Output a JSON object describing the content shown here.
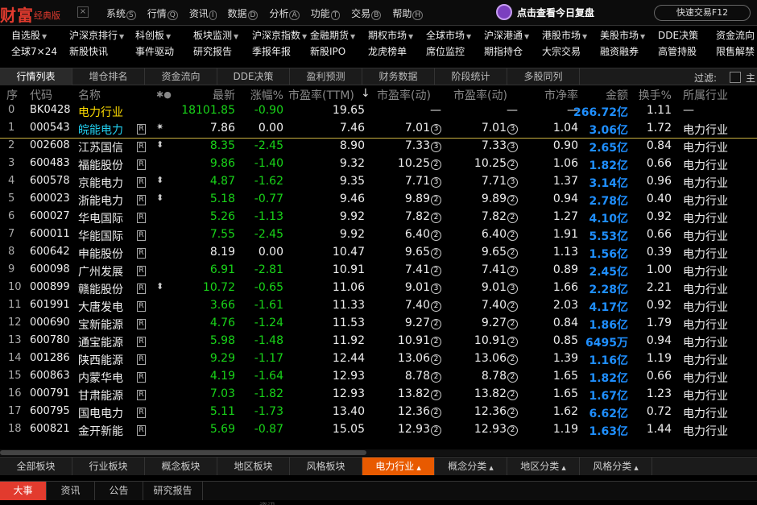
{
  "app": {
    "logo": "财富",
    "edition": "经典版",
    "close": "×"
  },
  "menu": [
    {
      "label": "系统",
      "key": "S"
    },
    {
      "label": "行情",
      "key": "Q"
    },
    {
      "label": "资讯",
      "key": "I"
    },
    {
      "label": "数据",
      "key": "D"
    },
    {
      "label": "分析",
      "key": "A"
    },
    {
      "label": "功能",
      "key": "T"
    },
    {
      "label": "交易",
      "key": "B"
    },
    {
      "label": "帮助",
      "key": "H"
    }
  ],
  "promo": "点击查看今日复盘",
  "quick_trade": "快速交易F12",
  "nav_row1": [
    "自选股",
    "沪深京排行",
    "科创板",
    "板块监测",
    "沪深京指数",
    "金融期货",
    "期权市场",
    "全球市场",
    "沪深港通",
    "港股市场",
    "美股市场",
    "DDE决策",
    "资金流向"
  ],
  "nav_row2": [
    "全球7×24",
    "新股快讯",
    "事件驱动",
    "研究报告",
    "季报年报",
    "新股IPO",
    "龙虎榜单",
    "席位监控",
    "期指持仓",
    "大宗交易",
    "融资融券",
    "高管持股",
    "限售解禁"
  ],
  "tabs": [
    "行情列表",
    "增仓排名",
    "资金流向",
    "DDE决策",
    "盈利预测",
    "财务数据",
    "阶段统计",
    "多股同列"
  ],
  "filter_label": "过滤:",
  "filter_more": "主",
  "headers": {
    "idx": "序",
    "code": "代码",
    "name": "名称",
    "flag": "✱●",
    "price": "最新",
    "chg": "涨幅%",
    "pe_ttm": "市盈率(TTM)",
    "sort": "↓",
    "pe_dyn": "市盈率(动)",
    "pe_dyn2": "市盈率(动)",
    "pb": "市净率",
    "amount": "金额",
    "turnover": "换手%",
    "industry": "所属行业"
  },
  "rows": [
    {
      "idx": "0",
      "code": "BK0428",
      "name": "电力行业",
      "r": "",
      "flag": "",
      "price": "18101.85",
      "chg": "-0.90",
      "pe": "19.65",
      "pe2": "—",
      "pe2r": "",
      "pe3": "—",
      "pe3r": "",
      "pb": "—",
      "amt": "266.72",
      "unit": "亿",
      "turn": "1.11",
      "ind": "—",
      "dir": "down",
      "nameColor": "yellow"
    },
    {
      "idx": "1",
      "code": "000543",
      "name": "皖能电力",
      "r": "R",
      "flag": "✷",
      "price": "7.86",
      "chg": "0.00",
      "pe": "7.46",
      "pe2": "7.01",
      "pe2r": "3",
      "pe3": "7.01",
      "pe3r": "3",
      "pb": "1.04",
      "amt": "3.06",
      "unit": "亿",
      "turn": "1.72",
      "ind": "电力行业",
      "dir": "flat",
      "nameColor": "cyan"
    },
    {
      "idx": "2",
      "code": "002608",
      "name": "江苏国信",
      "r": "R",
      "flag": "⬍",
      "price": "8.35",
      "chg": "-2.45",
      "pe": "8.90",
      "pe2": "7.33",
      "pe2r": "3",
      "pe3": "7.33",
      "pe3r": "3",
      "pb": "0.90",
      "amt": "2.65",
      "unit": "亿",
      "turn": "0.84",
      "ind": "电力行业",
      "dir": "down"
    },
    {
      "idx": "3",
      "code": "600483",
      "name": "福能股份",
      "r": "R",
      "flag": "",
      "price": "9.86",
      "chg": "-1.40",
      "pe": "9.32",
      "pe2": "10.25",
      "pe2r": "2",
      "pe3": "10.25",
      "pe3r": "2",
      "pb": "1.06",
      "amt": "1.82",
      "unit": "亿",
      "turn": "0.66",
      "ind": "电力行业",
      "dir": "down"
    },
    {
      "idx": "4",
      "code": "600578",
      "name": "京能电力",
      "r": "R",
      "flag": "⬍",
      "price": "4.87",
      "chg": "-1.62",
      "pe": "9.35",
      "pe2": "7.71",
      "pe2r": "3",
      "pe3": "7.71",
      "pe3r": "3",
      "pb": "1.37",
      "amt": "3.14",
      "unit": "亿",
      "turn": "0.96",
      "ind": "电力行业",
      "dir": "down"
    },
    {
      "idx": "5",
      "code": "600023",
      "name": "浙能电力",
      "r": "R",
      "flag": "⬍",
      "price": "5.18",
      "chg": "-0.77",
      "pe": "9.46",
      "pe2": "9.89",
      "pe2r": "2",
      "pe3": "9.89",
      "pe3r": "2",
      "pb": "0.94",
      "amt": "2.78",
      "unit": "亿",
      "turn": "0.40",
      "ind": "电力行业",
      "dir": "down"
    },
    {
      "idx": "6",
      "code": "600027",
      "name": "华电国际",
      "r": "R",
      "flag": "",
      "price": "5.26",
      "chg": "-1.13",
      "pe": "9.92",
      "pe2": "7.82",
      "pe2r": "2",
      "pe3": "7.82",
      "pe3r": "2",
      "pb": "1.27",
      "amt": "4.10",
      "unit": "亿",
      "turn": "0.92",
      "ind": "电力行业",
      "dir": "down"
    },
    {
      "idx": "7",
      "code": "600011",
      "name": "华能国际",
      "r": "R",
      "flag": "",
      "price": "7.55",
      "chg": "-2.45",
      "pe": "9.92",
      "pe2": "6.40",
      "pe2r": "2",
      "pe3": "6.40",
      "pe3r": "2",
      "pb": "1.91",
      "amt": "5.53",
      "unit": "亿",
      "turn": "0.66",
      "ind": "电力行业",
      "dir": "down"
    },
    {
      "idx": "8",
      "code": "600642",
      "name": "申能股份",
      "r": "R",
      "flag": "",
      "price": "8.19",
      "chg": "0.00",
      "pe": "10.47",
      "pe2": "9.65",
      "pe2r": "2",
      "pe3": "9.65",
      "pe3r": "2",
      "pb": "1.13",
      "amt": "1.56",
      "unit": "亿",
      "turn": "0.39",
      "ind": "电力行业",
      "dir": "flat"
    },
    {
      "idx": "9",
      "code": "600098",
      "name": "广州发展",
      "r": "R",
      "flag": "",
      "price": "6.91",
      "chg": "-2.81",
      "pe": "10.91",
      "pe2": "7.41",
      "pe2r": "2",
      "pe3": "7.41",
      "pe3r": "2",
      "pb": "0.89",
      "amt": "2.45",
      "unit": "亿",
      "turn": "1.00",
      "ind": "电力行业",
      "dir": "down"
    },
    {
      "idx": "10",
      "code": "000899",
      "name": "赣能股份",
      "r": "R",
      "flag": "⬍",
      "price": "10.72",
      "chg": "-0.65",
      "pe": "11.06",
      "pe2": "9.01",
      "pe2r": "3",
      "pe3": "9.01",
      "pe3r": "3",
      "pb": "1.66",
      "amt": "2.28",
      "unit": "亿",
      "turn": "2.21",
      "ind": "电力行业",
      "dir": "down"
    },
    {
      "idx": "11",
      "code": "601991",
      "name": "大唐发电",
      "r": "R",
      "flag": "",
      "price": "3.66",
      "chg": "-1.61",
      "pe": "11.33",
      "pe2": "7.40",
      "pe2r": "2",
      "pe3": "7.40",
      "pe3r": "2",
      "pb": "2.03",
      "amt": "4.17",
      "unit": "亿",
      "turn": "0.92",
      "ind": "电力行业",
      "dir": "down"
    },
    {
      "idx": "12",
      "code": "000690",
      "name": "宝新能源",
      "r": "R",
      "flag": "",
      "price": "4.76",
      "chg": "-1.24",
      "pe": "11.53",
      "pe2": "9.27",
      "pe2r": "2",
      "pe3": "9.27",
      "pe3r": "2",
      "pb": "0.84",
      "amt": "1.86",
      "unit": "亿",
      "turn": "1.79",
      "ind": "电力行业",
      "dir": "down"
    },
    {
      "idx": "13",
      "code": "600780",
      "name": "通宝能源",
      "r": "R",
      "flag": "",
      "price": "5.98",
      "chg": "-1.48",
      "pe": "11.92",
      "pe2": "10.91",
      "pe2r": "2",
      "pe3": "10.91",
      "pe3r": "2",
      "pb": "0.85",
      "amt": "6495",
      "unit": "万",
      "turn": "0.94",
      "ind": "电力行业",
      "dir": "down"
    },
    {
      "idx": "14",
      "code": "001286",
      "name": "陕西能源",
      "r": "R",
      "flag": "",
      "price": "9.29",
      "chg": "-1.17",
      "pe": "12.44",
      "pe2": "13.06",
      "pe2r": "2",
      "pe3": "13.06",
      "pe3r": "2",
      "pb": "1.39",
      "amt": "1.16",
      "unit": "亿",
      "turn": "1.19",
      "ind": "电力行业",
      "dir": "down"
    },
    {
      "idx": "15",
      "code": "600863",
      "name": "内蒙华电",
      "r": "R",
      "flag": "",
      "price": "4.19",
      "chg": "-1.64",
      "pe": "12.93",
      "pe2": "8.78",
      "pe2r": "2",
      "pe3": "8.78",
      "pe3r": "2",
      "pb": "1.65",
      "amt": "1.82",
      "unit": "亿",
      "turn": "0.66",
      "ind": "电力行业",
      "dir": "down"
    },
    {
      "idx": "16",
      "code": "000791",
      "name": "甘肃能源",
      "r": "R",
      "flag": "",
      "price": "7.03",
      "chg": "-1.82",
      "pe": "12.93",
      "pe2": "13.82",
      "pe2r": "2",
      "pe3": "13.82",
      "pe3r": "2",
      "pb": "1.65",
      "amt": "1.67",
      "unit": "亿",
      "turn": "1.23",
      "ind": "电力行业",
      "dir": "down"
    },
    {
      "idx": "17",
      "code": "600795",
      "name": "国电电力",
      "r": "R",
      "flag": "",
      "price": "5.11",
      "chg": "-1.73",
      "pe": "13.40",
      "pe2": "12.36",
      "pe2r": "2",
      "pe3": "12.36",
      "pe3r": "2",
      "pb": "1.62",
      "amt": "6.62",
      "unit": "亿",
      "turn": "0.72",
      "ind": "电力行业",
      "dir": "down"
    },
    {
      "idx": "18",
      "code": "600821",
      "name": "金开新能",
      "r": "R",
      "flag": "",
      "price": "5.69",
      "chg": "-0.87",
      "pe": "15.05",
      "pe2": "12.93",
      "pe2r": "2",
      "pe3": "12.93",
      "pe3r": "2",
      "pb": "1.19",
      "amt": "1.63",
      "unit": "亿",
      "turn": "1.44",
      "ind": "电力行业",
      "dir": "down"
    }
  ],
  "sector_tabs": [
    {
      "label": "全部板块",
      "dd": false
    },
    {
      "label": "行业板块",
      "dd": false
    },
    {
      "label": "概念板块",
      "dd": false
    },
    {
      "label": "地区板块",
      "dd": false
    },
    {
      "label": "风格板块",
      "dd": false
    },
    {
      "label": "电力行业",
      "dd": true
    },
    {
      "label": "概念分类",
      "dd": true
    },
    {
      "label": "地区分类",
      "dd": true
    },
    {
      "label": "风格分类",
      "dd": true
    }
  ],
  "news_tabs": [
    "大事",
    "资讯",
    "公告",
    "研究报告"
  ],
  "footer_text": "资讯",
  "colors": {
    "up": "#ff3b3b",
    "down": "#19d419",
    "amount": "#1f8fff",
    "accent_orange": "#e85a00",
    "accent_red": "#e23b2e"
  }
}
